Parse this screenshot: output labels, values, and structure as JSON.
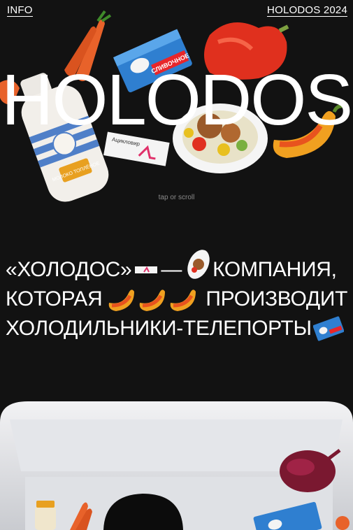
{
  "nav": {
    "info_label": "INFO",
    "brand_label": "HOLODOS 2024"
  },
  "hero": {
    "title": "HOLODOS",
    "hint": "tap or scroll"
  },
  "manifest": {
    "line1_a": "«ХОЛОДОС»",
    "line1_b": "—",
    "line1_c": "КОМПАНИЯ,",
    "line2_a": "КОТОРАЯ",
    "line2_b": "ПРОИЗВОДИТ",
    "line3_a": "ХОЛОДИЛЬНИКИ-ТЕЛЕПОРТЫ"
  },
  "product_labels": {
    "milk": "МОЛОКО ТОПЛЁНОЕ",
    "butter": "СЛИВОЧНОЕ",
    "pharmacy": "Ацикловир"
  },
  "colors": {
    "background": "#121212",
    "text": "#ffffff",
    "hint": "#8a8a8a",
    "carrot": "#e8622a",
    "pepper": "#e0301e",
    "yellow_pepper": "#f0a020",
    "butter_box": "#2f7fd0"
  },
  "icons": [
    "carrot-icon",
    "butter-icon",
    "pepper-icon",
    "milk-bottle-icon",
    "pill-box-icon",
    "food-plate-icon",
    "chili-icon",
    "onion-icon"
  ]
}
